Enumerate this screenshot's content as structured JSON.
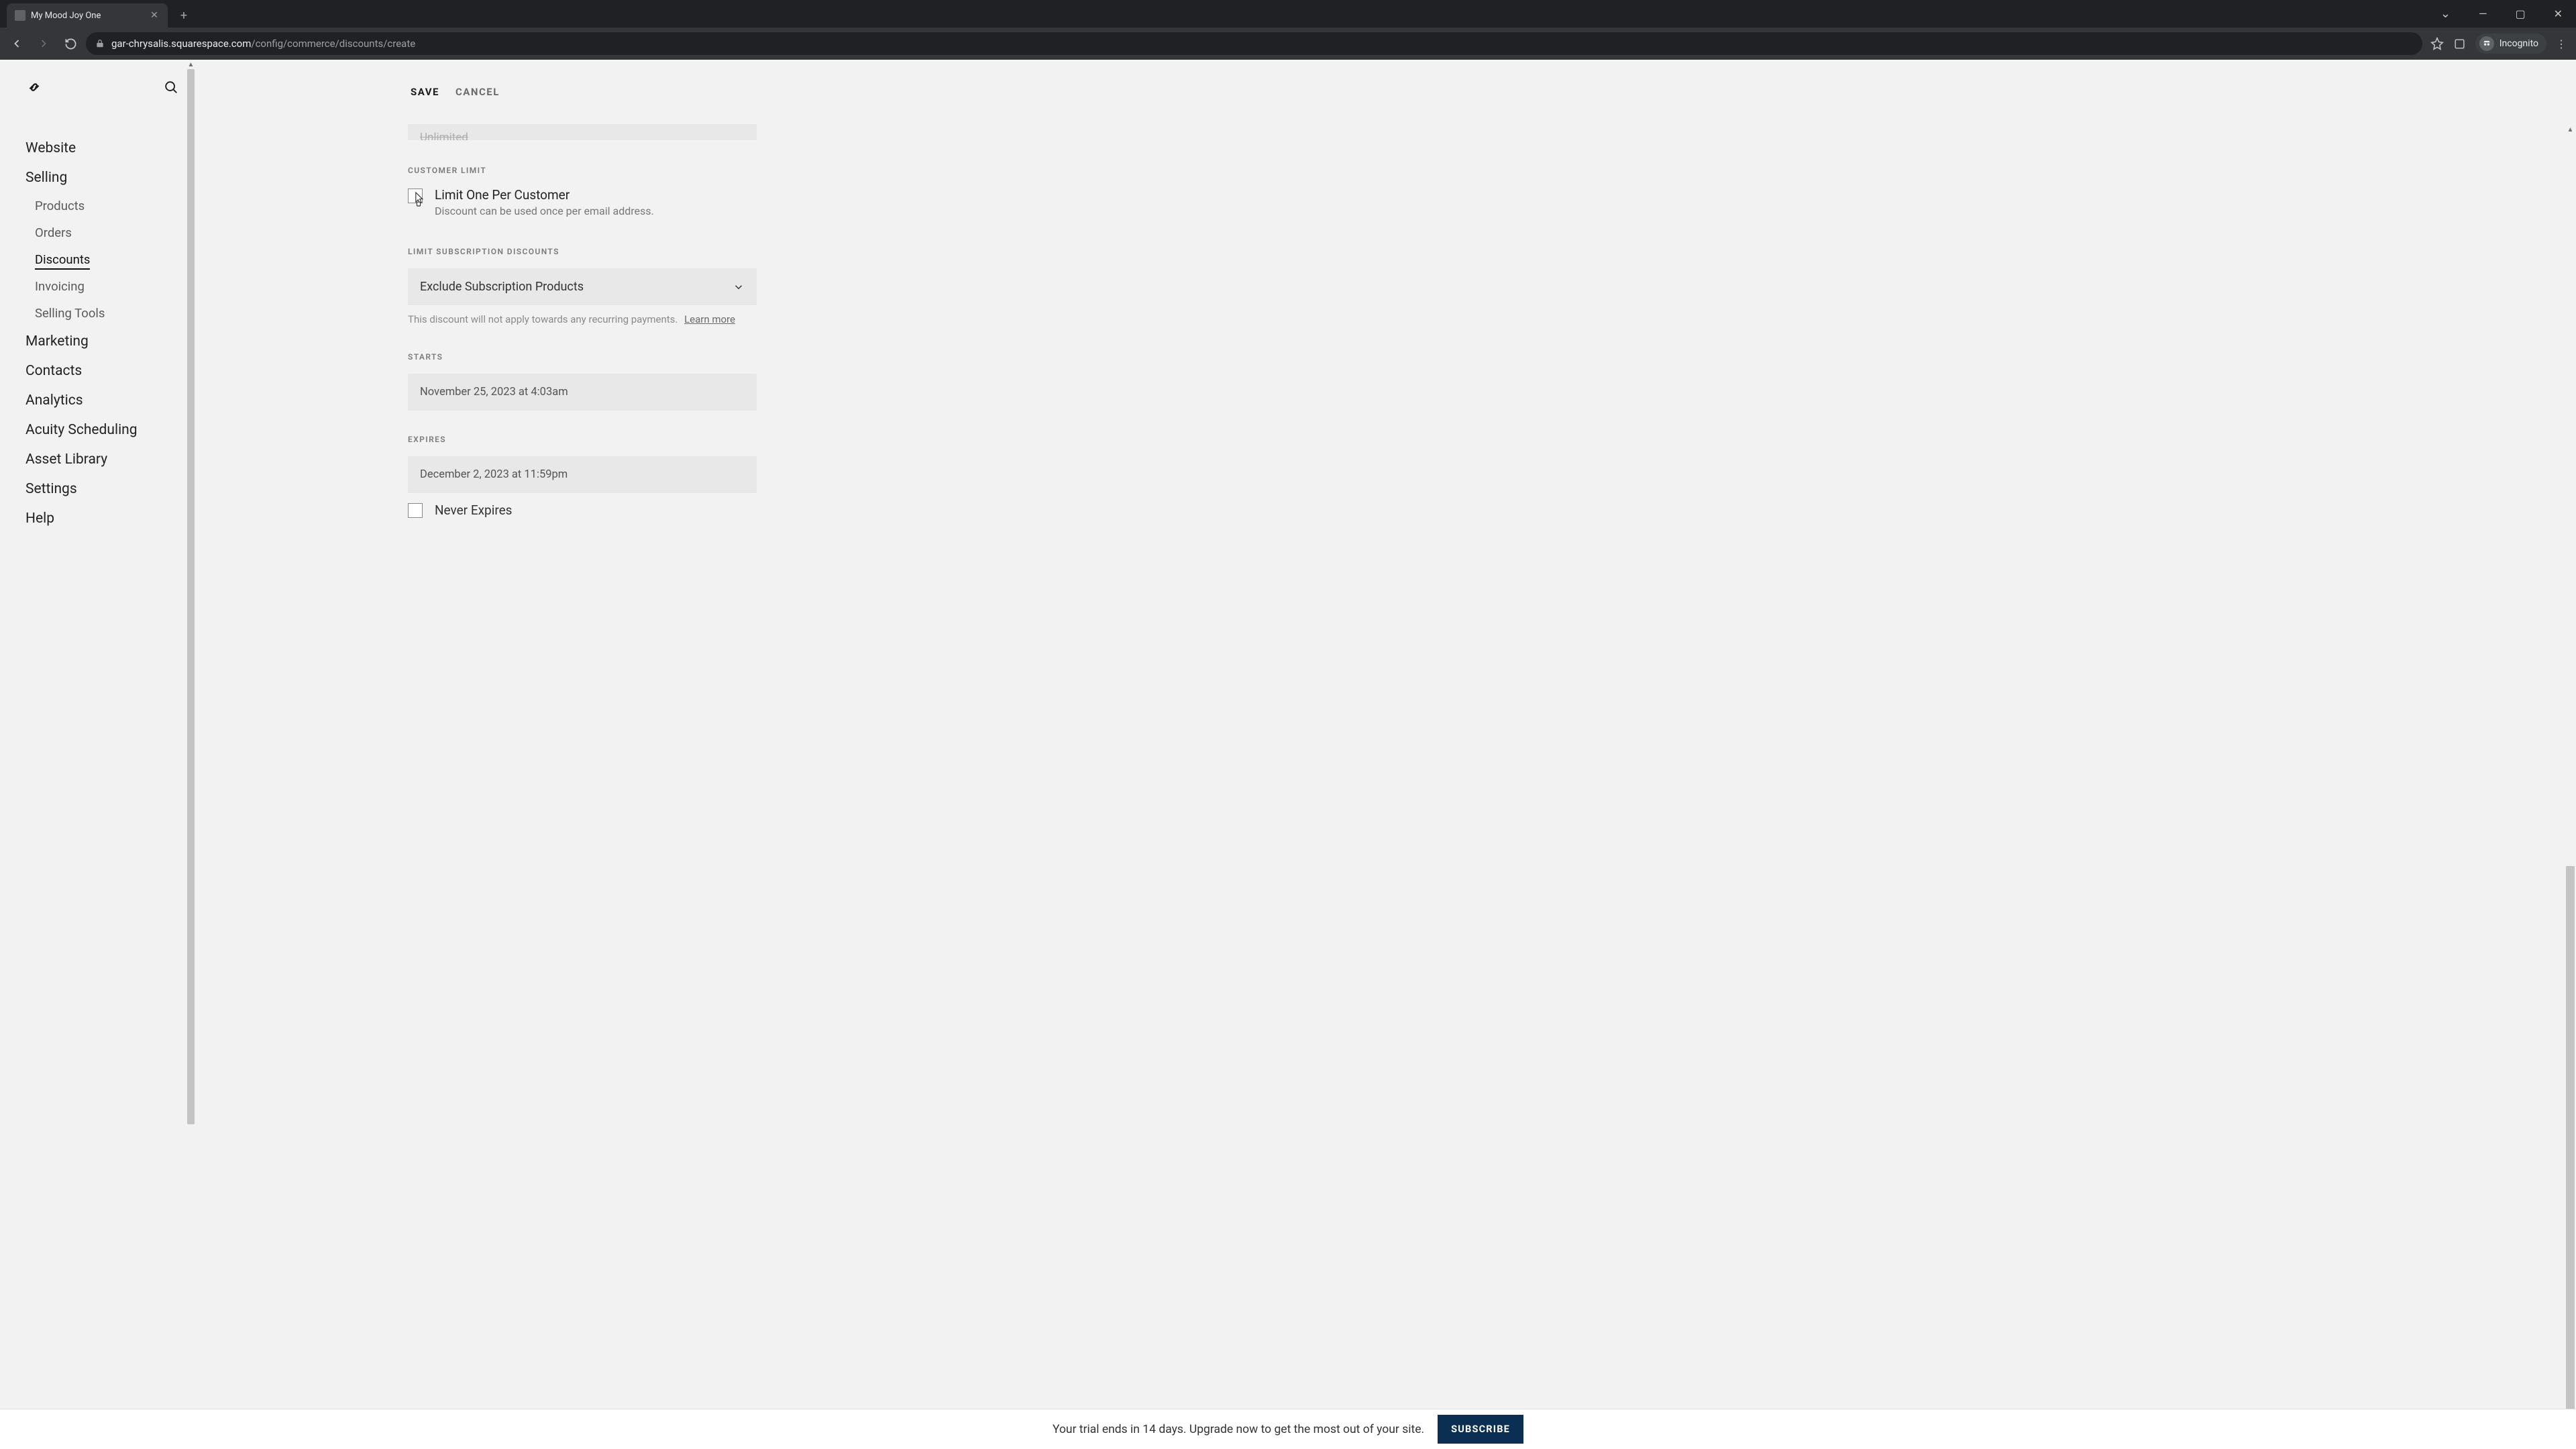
{
  "browser": {
    "tab_title": "My Mood Joy One",
    "url_host": "gar-chrysalis.squarespace.com",
    "url_path": "/config/commerce/discounts/create",
    "incognito_label": "Incognito"
  },
  "sidebar": {
    "items": [
      {
        "label": "Website"
      },
      {
        "label": "Selling"
      },
      {
        "label": "Marketing"
      },
      {
        "label": "Contacts"
      },
      {
        "label": "Analytics"
      },
      {
        "label": "Acuity Scheduling"
      },
      {
        "label": "Asset Library"
      },
      {
        "label": "Settings"
      },
      {
        "label": "Help"
      }
    ],
    "selling_sub": [
      {
        "label": "Products"
      },
      {
        "label": "Orders"
      },
      {
        "label": "Discounts",
        "active": true
      },
      {
        "label": "Invoicing"
      },
      {
        "label": "Selling Tools"
      }
    ]
  },
  "actions": {
    "save": "SAVE",
    "cancel": "CANCEL"
  },
  "form": {
    "cutoff_value": "Unlimited",
    "customer_limit": {
      "section": "CUSTOMER LIMIT",
      "title": "Limit One Per Customer",
      "desc": "Discount can be used once per email address."
    },
    "subscription": {
      "section": "LIMIT SUBSCRIPTION DISCOUNTS",
      "value": "Exclude Subscription Products",
      "helper": "This discount will not apply towards any recurring payments.",
      "learn_more": "Learn more"
    },
    "starts": {
      "section": "STARTS",
      "value": "November 25, 2023 at 4:03am"
    },
    "expires": {
      "section": "EXPIRES",
      "value": "December 2, 2023 at 11:59pm",
      "never_label": "Never Expires"
    }
  },
  "banner": {
    "message": "Your trial ends in 14 days. Upgrade now to get the most out of your site.",
    "button": "SUBSCRIBE"
  }
}
